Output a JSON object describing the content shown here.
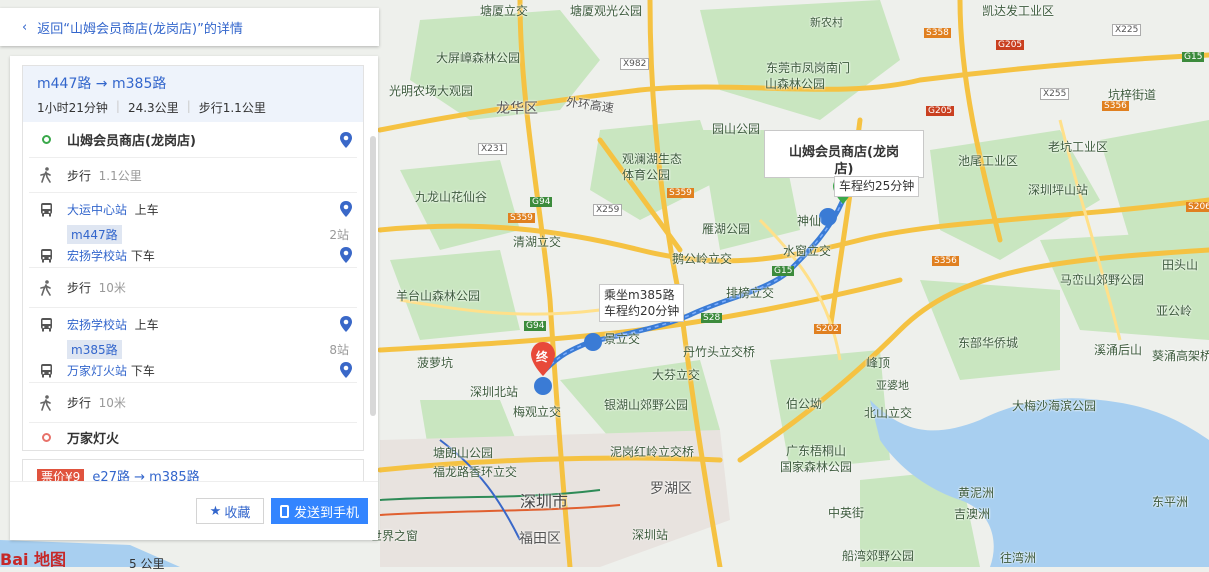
{
  "back_link": {
    "text": "返回“山姆会员商店(龙岗店)”的详情"
  },
  "route": {
    "title": "m447路 → m385路",
    "duration": "1小时21分钟",
    "distance": "24.3公里",
    "walk": "步行1.1公里",
    "steps": [
      {
        "type": "start",
        "text": "山姆会员商店(龙岗店)"
      },
      {
        "type": "walk",
        "text": "步行",
        "detail": "1.1公里"
      },
      {
        "type": "board",
        "station": "大运中心站",
        "action": "上车"
      },
      {
        "type": "line",
        "line": "m447路",
        "stops": "2站"
      },
      {
        "type": "alight",
        "station": "宏扬学校站",
        "action": "下车"
      },
      {
        "type": "walk",
        "text": "步行",
        "detail": "10米"
      },
      {
        "type": "board",
        "station": "宏扬学校站",
        "action": "上车"
      },
      {
        "type": "line",
        "line": "m385路",
        "stops": "8站"
      },
      {
        "type": "alight",
        "station": "万家灯火站",
        "action": "下车"
      },
      {
        "type": "walk",
        "text": "步行",
        "detail": "10米"
      },
      {
        "type": "end",
        "text": "万家灯火"
      }
    ]
  },
  "route2": {
    "price": "票价¥9",
    "title": "e27路 → m385路"
  },
  "buttons": {
    "favorite": "收藏",
    "send": "发送到手机"
  },
  "map": {
    "bubble_dest": "山姆会员商店(龙岗店)",
    "bubble_time1": "车程约25分钟",
    "bubble_bus_line": "乘坐m385路",
    "bubble_bus_time": "车程约20分钟",
    "end_marker": "终",
    "labels": [
      {
        "t": "塘厦立交"
      },
      {
        "t": "塘厦观光公园"
      },
      {
        "t": "凯达发工业区"
      },
      {
        "t": "大屏嶂森林公园"
      },
      {
        "t": "光明农场大观园"
      },
      {
        "t": "龙华区"
      },
      {
        "t": "外环高速"
      },
      {
        "t": "东莞市凤岗南门"
      },
      {
        "t": "山森林公园"
      },
      {
        "t": "园山公园"
      },
      {
        "t": "观澜湖生态"
      },
      {
        "t": "体育公园"
      },
      {
        "t": "九龙山花仙谷"
      },
      {
        "t": "清湖立交"
      },
      {
        "t": "雁湖公园"
      },
      {
        "t": "神仙"
      },
      {
        "t": "鹅公岭立交"
      },
      {
        "t": "水窗立交"
      },
      {
        "t": "排榜立交"
      },
      {
        "t": "羊台山森林公园"
      },
      {
        "t": "景立交"
      },
      {
        "t": "丹竹头立交桥"
      },
      {
        "t": "菠萝坑"
      },
      {
        "t": "深圳北站"
      },
      {
        "t": "梅观立交"
      },
      {
        "t": "大芬立交"
      },
      {
        "t": "银湖山郊野公园"
      },
      {
        "t": "塘朗山公园"
      },
      {
        "t": "福龙路香环立交"
      },
      {
        "t": "泥岗红岭立交桥"
      },
      {
        "t": "深圳市"
      },
      {
        "t": "罗湖区"
      },
      {
        "t": "深圳站"
      },
      {
        "t": "福田区"
      },
      {
        "t": "世界之窗"
      },
      {
        "t": "池尾工业区"
      },
      {
        "t": "老坑工业区"
      },
      {
        "t": "深圳坪山站"
      },
      {
        "t": "坑梓街道"
      },
      {
        "t": "马峦山郊野公园"
      },
      {
        "t": "田头山"
      },
      {
        "t": "东部华侨城"
      },
      {
        "t": "溪涌后山"
      },
      {
        "t": "葵涌高架桥"
      },
      {
        "t": "峰顶"
      },
      {
        "t": "亚婆地"
      },
      {
        "t": "伯公坳"
      },
      {
        "t": "北山立交"
      },
      {
        "t": "大梅沙海滨公园"
      },
      {
        "t": "广东梧桐山"
      },
      {
        "t": "国家森林公园"
      },
      {
        "t": "黄泥洲"
      },
      {
        "t": "吉澳洲"
      },
      {
        "t": "中英街"
      },
      {
        "t": "东平洲"
      },
      {
        "t": "船湾郊野公园"
      },
      {
        "t": "往湾洲"
      },
      {
        "t": "亚公岭"
      },
      {
        "t": "新农村"
      },
      {
        "t": "凯达发工业区"
      }
    ],
    "roads": [
      {
        "t": "X982"
      },
      {
        "t": "X231"
      },
      {
        "t": "G94"
      },
      {
        "t": "S359"
      },
      {
        "t": "X259"
      },
      {
        "t": "S359"
      },
      {
        "t": "G15"
      },
      {
        "t": "S28"
      },
      {
        "t": "S202"
      },
      {
        "t": "S356"
      },
      {
        "t": "S358"
      },
      {
        "t": "G205"
      },
      {
        "t": "G205"
      },
      {
        "t": "X225"
      },
      {
        "t": "G15"
      },
      {
        "t": "X255"
      },
      {
        "t": "S356"
      },
      {
        "t": "S206"
      },
      {
        "t": "G94"
      }
    ],
    "scale": "5 公里",
    "logo": "Bai 地图"
  }
}
